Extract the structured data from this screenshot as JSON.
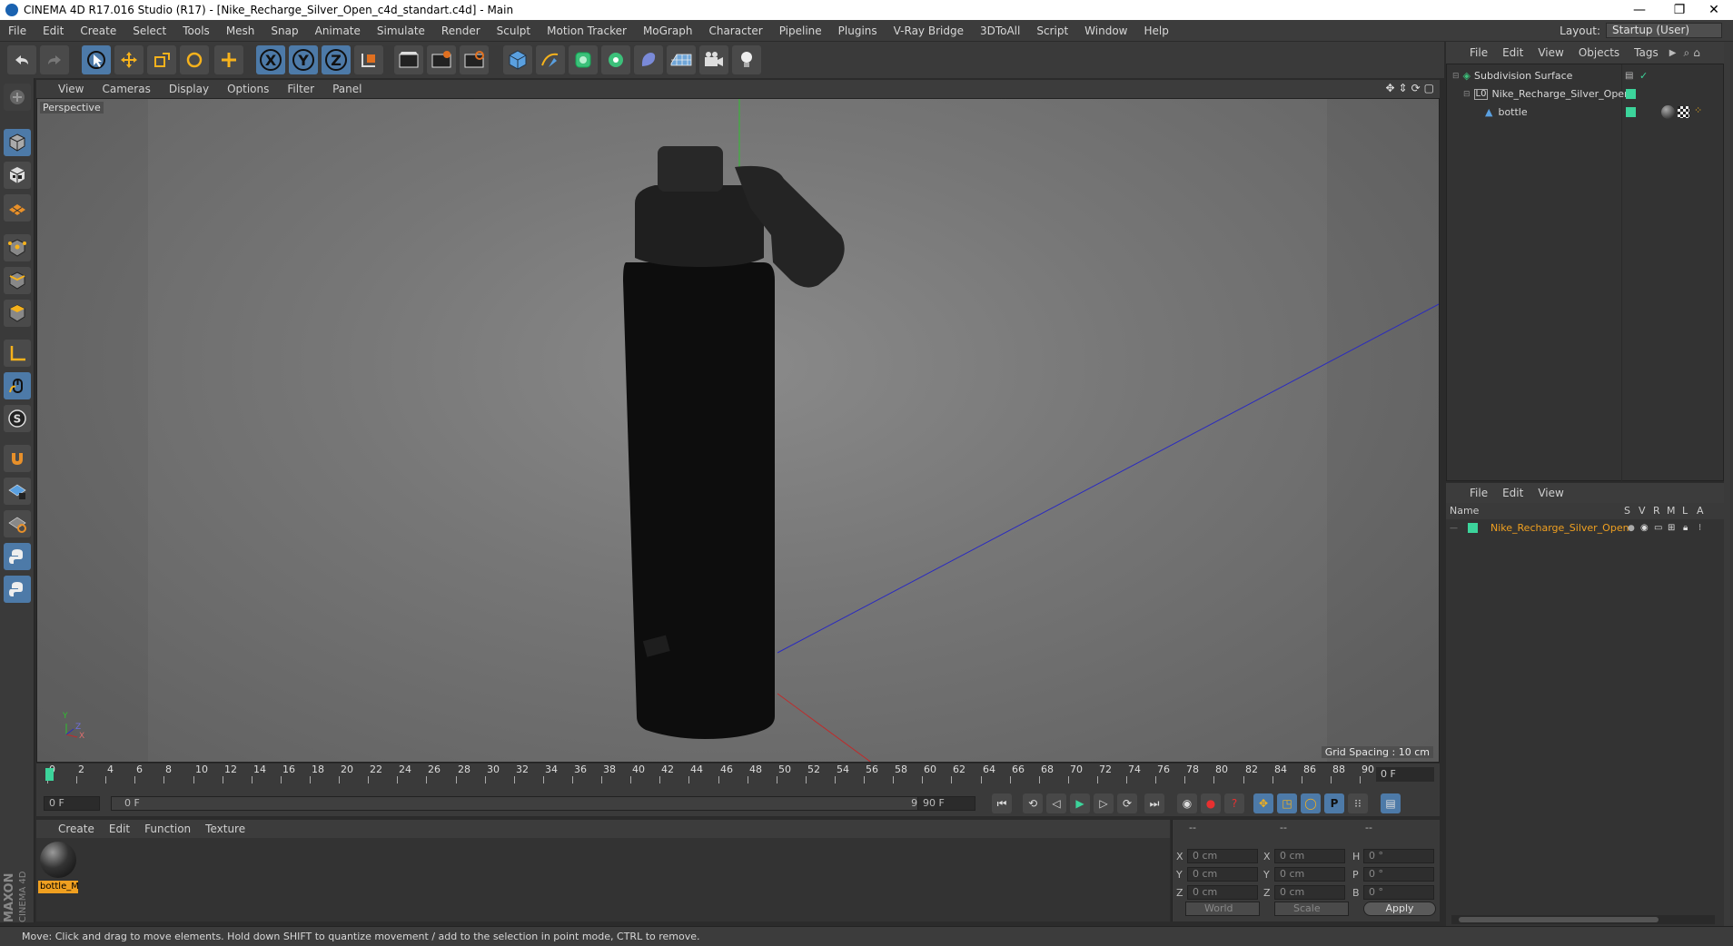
{
  "window": {
    "title": "CINEMA 4D R17.016 Studio (R17) - [Nike_Recharge_Silver_Open_c4d_standart.c4d] - Main",
    "minimize": "—",
    "restore": "❐",
    "close": "✕"
  },
  "menubar": {
    "items": [
      "File",
      "Edit",
      "Create",
      "Select",
      "Tools",
      "Mesh",
      "Snap",
      "Animate",
      "Simulate",
      "Render",
      "Sculpt",
      "Motion Tracker",
      "MoGraph",
      "Character",
      "Pipeline",
      "Plugins",
      "V-Ray Bridge",
      "3DToAll",
      "Script",
      "Window",
      "Help"
    ],
    "layout_label": "Layout:",
    "layout_value": "Startup (User)"
  },
  "viewport": {
    "menu": [
      "View",
      "Cameras",
      "Display",
      "Options",
      "Filter",
      "Panel"
    ],
    "camera_label": "Perspective",
    "grid_spacing": "Grid Spacing : 10 cm",
    "axis_y": "Y",
    "axis_z": "Z",
    "axis_x": "X"
  },
  "timeline": {
    "ticks": [
      "0",
      "2",
      "4",
      "6",
      "8",
      "10",
      "12",
      "14",
      "16",
      "18",
      "20",
      "22",
      "24",
      "26",
      "28",
      "30",
      "32",
      "34",
      "36",
      "38",
      "40",
      "42",
      "44",
      "46",
      "48",
      "50",
      "52",
      "54",
      "56",
      "58",
      "60",
      "62",
      "64",
      "66",
      "68",
      "70",
      "72",
      "74",
      "76",
      "78",
      "80",
      "82",
      "84",
      "86",
      "88",
      "90"
    ],
    "current_frame": "0 F",
    "start_field": "0 F",
    "range_start": "0 F",
    "range_end": "90 F",
    "end_field": "90 F"
  },
  "material_manager": {
    "menu": [
      "Create",
      "Edit",
      "Function",
      "Texture"
    ],
    "material_name": "bottle_M"
  },
  "coordinates": {
    "header": [
      "--",
      "--",
      "--"
    ],
    "rows": [
      {
        "a": "X",
        "av": "0 cm",
        "b": "X",
        "bv": "0 cm",
        "c": "H",
        "cv": "0 °"
      },
      {
        "a": "Y",
        "av": "0 cm",
        "b": "Y",
        "bv": "0 cm",
        "c": "P",
        "cv": "0 °"
      },
      {
        "a": "Z",
        "av": "0 cm",
        "b": "Z",
        "bv": "0 cm",
        "c": "B",
        "cv": "0 °"
      }
    ],
    "space": "World",
    "mode": "Scale",
    "apply": "Apply"
  },
  "object_manager": {
    "menu": [
      "File",
      "Edit",
      "View",
      "Objects",
      "Tags"
    ],
    "objects": [
      {
        "name": "Subdivision Surface",
        "indent": 0
      },
      {
        "name": "Nike_Recharge_Silver_Open",
        "indent": 1
      },
      {
        "name": "bottle",
        "indent": 2
      }
    ]
  },
  "layer_manager": {
    "menu": [
      "File",
      "Edit",
      "View"
    ],
    "columns": [
      "Name",
      "S",
      "V",
      "R",
      "M",
      "L",
      "A"
    ],
    "layer_name": "Nike_Recharge_Silver_Open"
  },
  "status": "Move: Click and drag to move elements. Hold down SHIFT to quantize movement / add to the selection in point mode, CTRL to remove.",
  "brand": "MAXON CINEMA 4D",
  "colors": {
    "accent_blue": "#4d7aa8",
    "layer_green": "#3cd49b",
    "material_orange": "#f0a020",
    "layer_name_orange": "#f0a020"
  }
}
